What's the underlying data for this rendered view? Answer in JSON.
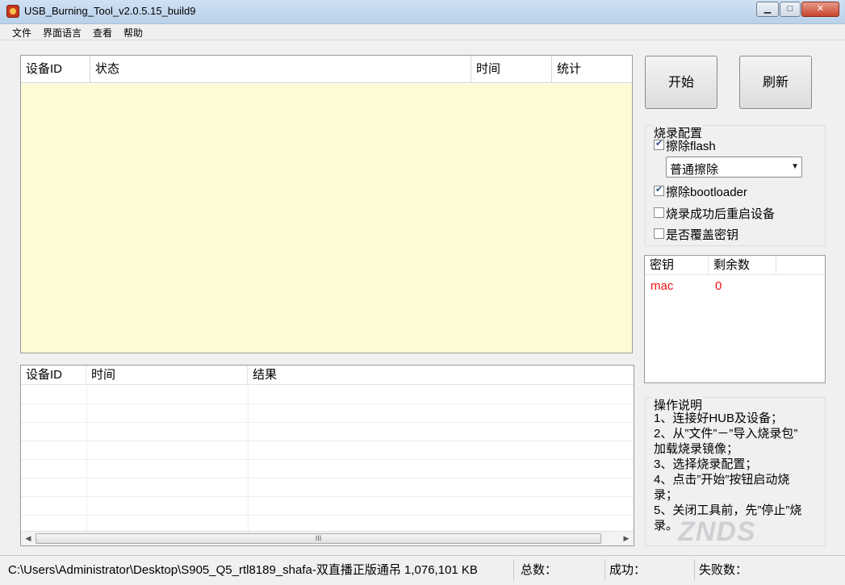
{
  "window": {
    "title": "USB_Burning_Tool_v2.0.5.15_build9",
    "controls": {
      "minimize": "▁",
      "maximize": "□",
      "close": "✕"
    }
  },
  "menu": [
    "文件",
    "界面语言",
    "查看",
    "帮助"
  ],
  "device_table": {
    "headers": [
      "设备ID",
      "状态",
      "时间",
      "统计"
    ]
  },
  "result_table": {
    "headers": [
      "设备ID",
      "时间",
      "结果"
    ],
    "scroll_thumb_grip": "III"
  },
  "buttons": {
    "start": "开始",
    "refresh": "刷新"
  },
  "burn_config": {
    "title": "烧录配置",
    "erase_flash": {
      "label": "擦除flash",
      "checked": true
    },
    "erase_mode": "普通擦除",
    "erase_bootloader": {
      "label": "擦除bootloader",
      "checked": true
    },
    "reboot_after_success": {
      "label": "烧录成功后重启设备",
      "checked": false
    },
    "overwrite_key": {
      "label": "是否覆盖密钥",
      "checked": false
    }
  },
  "key_table": {
    "headers": [
      "密钥",
      "剩余数"
    ],
    "rows": [
      {
        "key": "mac",
        "remaining": "0"
      }
    ],
    "row_color": "#ee1111"
  },
  "instructions": {
    "title": "操作说明",
    "lines": [
      "1、连接好HUB及设备；",
      "2、从”文件”－”导入烧录包”",
      "加载烧录镜像；",
      "3、选择烧录配置；",
      "4、点击”开始”按钮启动烧",
      "录；",
      "5、关闭工具前，先”停止”烧",
      "录。"
    ]
  },
  "status_bar": {
    "path": "C:\\Users\\Administrator\\Desktop\\S905_Q5_rtl8189_shafa-双直播正版通吊 1,076,101 KB",
    "total": "总数：",
    "success": "成功：",
    "failed": "失败数："
  },
  "watermark": "ZNDS"
}
